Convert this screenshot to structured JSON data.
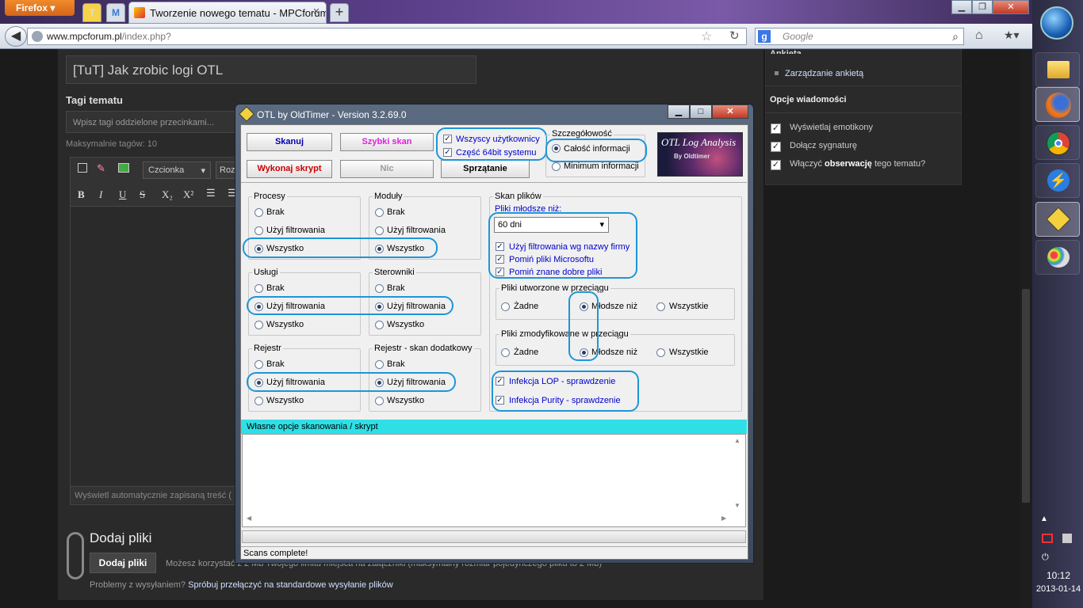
{
  "browser": {
    "app_button": "Firefox",
    "pinned_tabs": [
      "T",
      "M"
    ],
    "active_tab_title": "Tworzenie nowego tematu - MPCforum - ...",
    "url_host": "www.mpcforum.pl",
    "url_path": "/index.php?",
    "search_placeholder": "Google",
    "search_engine_icon": "g-icon"
  },
  "page": {
    "topic_title_value": "[TuT] Jak zrobic logi OTL",
    "tags_label": "Tagi tematu",
    "tags_placeholder": "Wpisz tagi oddzielone przecinkami...",
    "max_tags": "Maksymalnie tagów: 10",
    "editor": {
      "font_select": "Czcionka",
      "size_select": "Roz",
      "autosave": "Wyświetl automatycznie zapisaną treść (",
      "buttons": [
        "B",
        "I",
        "U",
        "S",
        "X₂",
        "X²"
      ]
    },
    "add_files": {
      "title": "Dodaj pliki",
      "button": "Dodaj pliki",
      "info": "Możesz korzystać z 2 Mb Twojego limitu miejsca na załączniki (maksymalny rozmiar pojedynczego pliku to 2 Mb)",
      "problem_prefix": "Problemy z wysyłaniem?",
      "problem_link": "Spróbuj przełączyć na standardowe wysyłanie plików"
    },
    "sidebar": {
      "survey_head": "Ankieta",
      "survey_link": "Zarządzanie ankietą",
      "options_head": "Opcje wiadomości",
      "options": [
        {
          "label": "Wyświetlaj emotikony",
          "checked": true
        },
        {
          "label": "Dołącz sygnaturę",
          "checked": true
        },
        {
          "label_pre": "Włączyć ",
          "label_bold": "obserwację",
          "label_post": " tego tematu?",
          "checked": true
        }
      ]
    }
  },
  "otl": {
    "title": "OTL by OldTimer - Version 3.2.69.0",
    "buttons": {
      "scan": "Skanuj",
      "quick_scan": "Szybki skan",
      "run_script": "Wykonaj skrypt",
      "none": "Nic",
      "cleanup": "Sprzątanie"
    },
    "all_users": {
      "label": "Wszyscy użytkownicy",
      "checked": true
    },
    "x64": {
      "label": "Część 64bit systemu",
      "checked": true
    },
    "detail": {
      "label": "Szczegółowość",
      "options": [
        "Całość informacji",
        "Minimum informacji"
      ],
      "selected": "Całość informacji"
    },
    "logo_text": "OTL Log Analysis",
    "logo_sub": "By Oldtimer",
    "groups": {
      "processes": {
        "label": "Procesy",
        "options": [
          "Brak",
          "Użyj filtrowania",
          "Wszystko"
        ],
        "selected": 2
      },
      "modules": {
        "label": "Moduły",
        "options": [
          "Brak",
          "Użyj filtrowania",
          "Wszystko"
        ],
        "selected": 2
      },
      "services": {
        "label": "Usługi",
        "options": [
          "Brak",
          "Użyj filtrowania",
          "Wszystko"
        ],
        "selected": 1
      },
      "drivers": {
        "label": "Sterowniki",
        "options": [
          "Brak",
          "Użyj filtrowania",
          "Wszystko"
        ],
        "selected": 1
      },
      "registry": {
        "label": "Rejestr",
        "options": [
          "Brak",
          "Użyj filtrowania",
          "Wszystko"
        ],
        "selected": 1
      },
      "registry_extra": {
        "label": "Rejestr - skan dodatkowy",
        "options": [
          "Brak",
          "Użyj filtrowania",
          "Wszystko"
        ],
        "selected": 1
      }
    },
    "file_scan": {
      "label": "Skan plików",
      "newer_than_label": "Pliki młodsze niż:",
      "newer_than_value": "60 dni",
      "checks": [
        {
          "label": "Użyj filtrowania wg nazwy firmy",
          "checked": true
        },
        {
          "label": "Pomiń pliki Microsoftu",
          "checked": true
        },
        {
          "label": "Pomiń znane dobre pliki",
          "checked": true
        }
      ],
      "created": {
        "label": "Pliki utworzone w przeciągu",
        "options": [
          "Żadne",
          "Młodsze niż",
          "Wszystkie"
        ],
        "selected": 1
      },
      "modified": {
        "label": "Pliki zmodyfikowane w przeciągu",
        "options": [
          "Żadne",
          "Młodsze niż",
          "Wszystkie"
        ],
        "selected": 1
      },
      "infections": [
        {
          "label": "Infekcja LOP - sprawdzenie",
          "checked": true
        },
        {
          "label": "Infekcja Purity - sprawdzenie",
          "checked": true
        }
      ]
    },
    "script_header": "Własne opcje skanowania / skrypt",
    "script_value": "",
    "status": "Scans complete!"
  },
  "taskbar": {
    "time": "10:12",
    "date": "2013-01-14",
    "apps": [
      "folder-icon",
      "firefox-icon",
      "chrome-icon",
      "thunder-icon",
      "otl-icon",
      "paint-icon"
    ]
  },
  "colors": {
    "highlight": "#1d96d8",
    "script_header_bg": "#2ee0e6",
    "quick_scan": "#e020e0",
    "run_script": "#cc0000",
    "scan": "#0000aa",
    "link_blue": "#0000cc"
  }
}
